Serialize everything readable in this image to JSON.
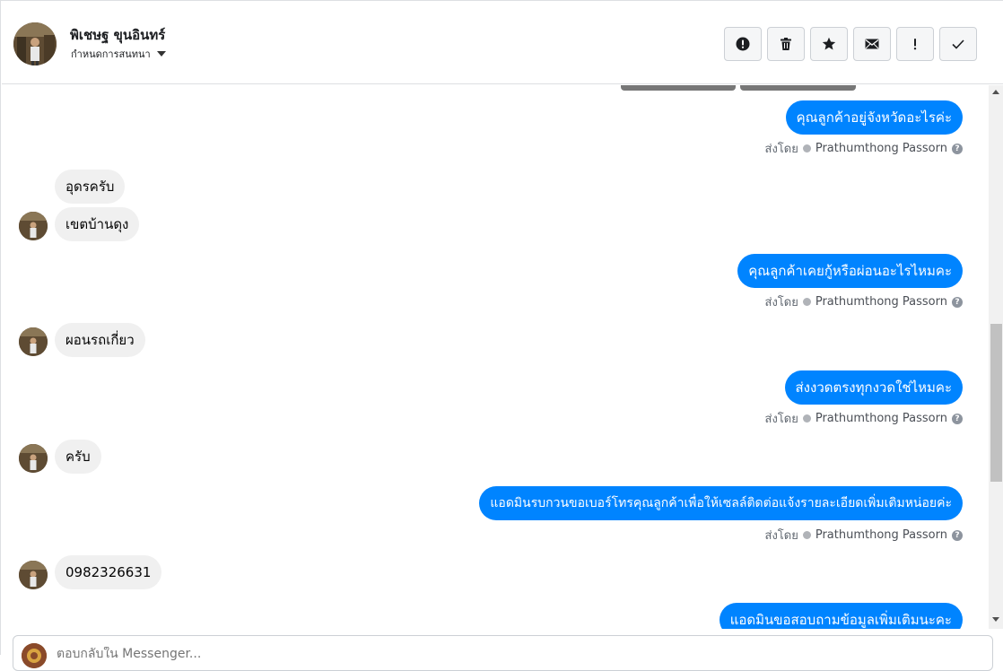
{
  "header": {
    "contact_name": "พิเชษฐ ขุนอินทร์",
    "assign_label": "กำหนดการสนทนา",
    "actions": [
      {
        "name": "spam-button",
        "icon": "alert-circle-icon"
      },
      {
        "name": "delete-button",
        "icon": "trash-icon"
      },
      {
        "name": "star-button",
        "icon": "star-icon"
      },
      {
        "name": "mark-unread-button",
        "icon": "envelope-icon"
      },
      {
        "name": "follow-up-button",
        "icon": "exclamation-icon"
      },
      {
        "name": "mark-done-button",
        "icon": "check-icon"
      }
    ]
  },
  "messages": {
    "m1": "คุณลูกค้าอยู่จังหวัดอะไรค่ะ",
    "m2": "อุดรครับ",
    "m3": "เขตบ้านดุง",
    "m4": "คุณลูกค้าเคยกู้หรือผ่อนอะไรไหมคะ",
    "m5": "ผอนรถเกี่ยว",
    "m6": "ส่งงวดตรงทุกงวดใช่ไหมคะ",
    "m7": "ครับ",
    "m8": "แอดมินรบกวนขอเบอร์โทรคุณลูกค้าเพื่อให้เซลล์ติดต่อแจ้งรายละเอียดเพิ่มเติมหน่อยค่ะ",
    "m9": "0982326631",
    "m10": "แอดมินขอสอบถามข้อมูลเพิ่มเติมนะคะ"
  },
  "sent_by": {
    "prefix": "ส่งโดย",
    "agent": "Prathumthong Passorn",
    "help": "?"
  },
  "composer": {
    "placeholder": "ตอบกลับใน Messenger..."
  },
  "colors": {
    "outgoing_bubble": "#0084ff",
    "incoming_bubble": "#f0f0f0"
  }
}
